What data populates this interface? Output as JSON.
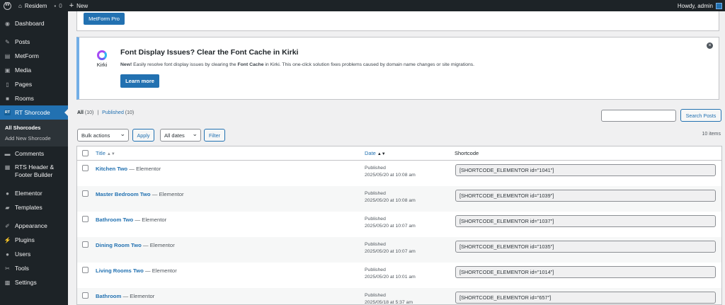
{
  "adminbar": {
    "site_name": "Residem",
    "comments_count": "0",
    "new_label": "New",
    "howdy": "Howdy, admin"
  },
  "sidebar": {
    "items": [
      {
        "label": "Dashboard",
        "icon": "dashboard-icon"
      },
      {
        "label": "Posts",
        "icon": "pin-icon"
      },
      {
        "label": "MetForm",
        "icon": "form-icon"
      },
      {
        "label": "Media",
        "icon": "media-icon"
      },
      {
        "label": "Pages",
        "icon": "page-icon"
      },
      {
        "label": "Rooms",
        "icon": "rooms-icon"
      },
      {
        "label": "RT Shorcode",
        "icon": "rt-icon",
        "badge": "RT"
      },
      {
        "label": "Comments",
        "icon": "comment-icon"
      },
      {
        "label": "RTS Header & Footer Builder",
        "icon": "builder-icon"
      },
      {
        "label": "Elementor",
        "icon": "elementor-icon"
      },
      {
        "label": "Templates",
        "icon": "folder-icon"
      },
      {
        "label": "Appearance",
        "icon": "brush-icon"
      },
      {
        "label": "Plugins",
        "icon": "plugin-icon"
      },
      {
        "label": "Users",
        "icon": "user-icon"
      },
      {
        "label": "Tools",
        "icon": "wrench-icon"
      },
      {
        "label": "Settings",
        "icon": "settings-icon"
      }
    ],
    "submenu": [
      "All Shorcodes",
      "Add New Shorcode"
    ]
  },
  "top_notice": {
    "button": "MetForm Pro"
  },
  "kirki_notice": {
    "logo_text": "Kirki",
    "title": "Font Display Issues? Clear the Font Cache in Kirki",
    "body_new": "New!",
    "body_1": " Easily resolve font display issues by clearing the ",
    "body_bold": "Font Cache",
    "body_2": " in Kirki. This one-click solution fixes problems caused by domain name changes or site migrations.",
    "button": "Learn more"
  },
  "views": {
    "all": "All",
    "all_count": "(10)",
    "sep": "|",
    "published": "Published",
    "published_count": "(10)"
  },
  "search": {
    "button": "Search Posts",
    "value": ""
  },
  "tablenav": {
    "bulk": "Bulk actions",
    "apply": "Apply",
    "dates": "All dates",
    "filter": "Filter",
    "count": "10 items"
  },
  "table": {
    "headers": {
      "title": "Title",
      "date": "Date",
      "shortcode": "Shortcode"
    },
    "rows": [
      {
        "title": "Kitchen Two",
        "suffix": " — Elementor",
        "status": "Published",
        "date": "2025/05/20 at 10:08 am",
        "shortcode": "[SHORTCODE_ELEMENTOR id=\"1041\"]"
      },
      {
        "title": "Master Bedroom Two",
        "suffix": " — Elementor",
        "status": "Published",
        "date": "2025/05/20 at 10:08 am",
        "shortcode": "[SHORTCODE_ELEMENTOR id=\"1039\"]"
      },
      {
        "title": "Bathroom Two",
        "suffix": " — Elementor",
        "status": "Published",
        "date": "2025/05/20 at 10:07 am",
        "shortcode": "[SHORTCODE_ELEMENTOR id=\"1037\"]"
      },
      {
        "title": "Dining Room Two",
        "suffix": " — Elementor",
        "status": "Published",
        "date": "2025/05/20 at 10:07 am",
        "shortcode": "[SHORTCODE_ELEMENTOR id=\"1035\"]"
      },
      {
        "title": "Living Rooms Two",
        "suffix": " — Elementor",
        "status": "Published",
        "date": "2025/05/20 at 10:01 am",
        "shortcode": "[SHORTCODE_ELEMENTOR id=\"1014\"]"
      },
      {
        "title": "Bathroom",
        "suffix": " — Elementor",
        "status": "Published",
        "date": "2025/05/18 at 5:37 am",
        "shortcode": "[SHORTCODE_ELEMENTOR id=\"657\"]"
      }
    ]
  },
  "colors": {
    "admin_dark": "#1d2327",
    "accent": "#2271b1",
    "link": "#2271b1"
  }
}
